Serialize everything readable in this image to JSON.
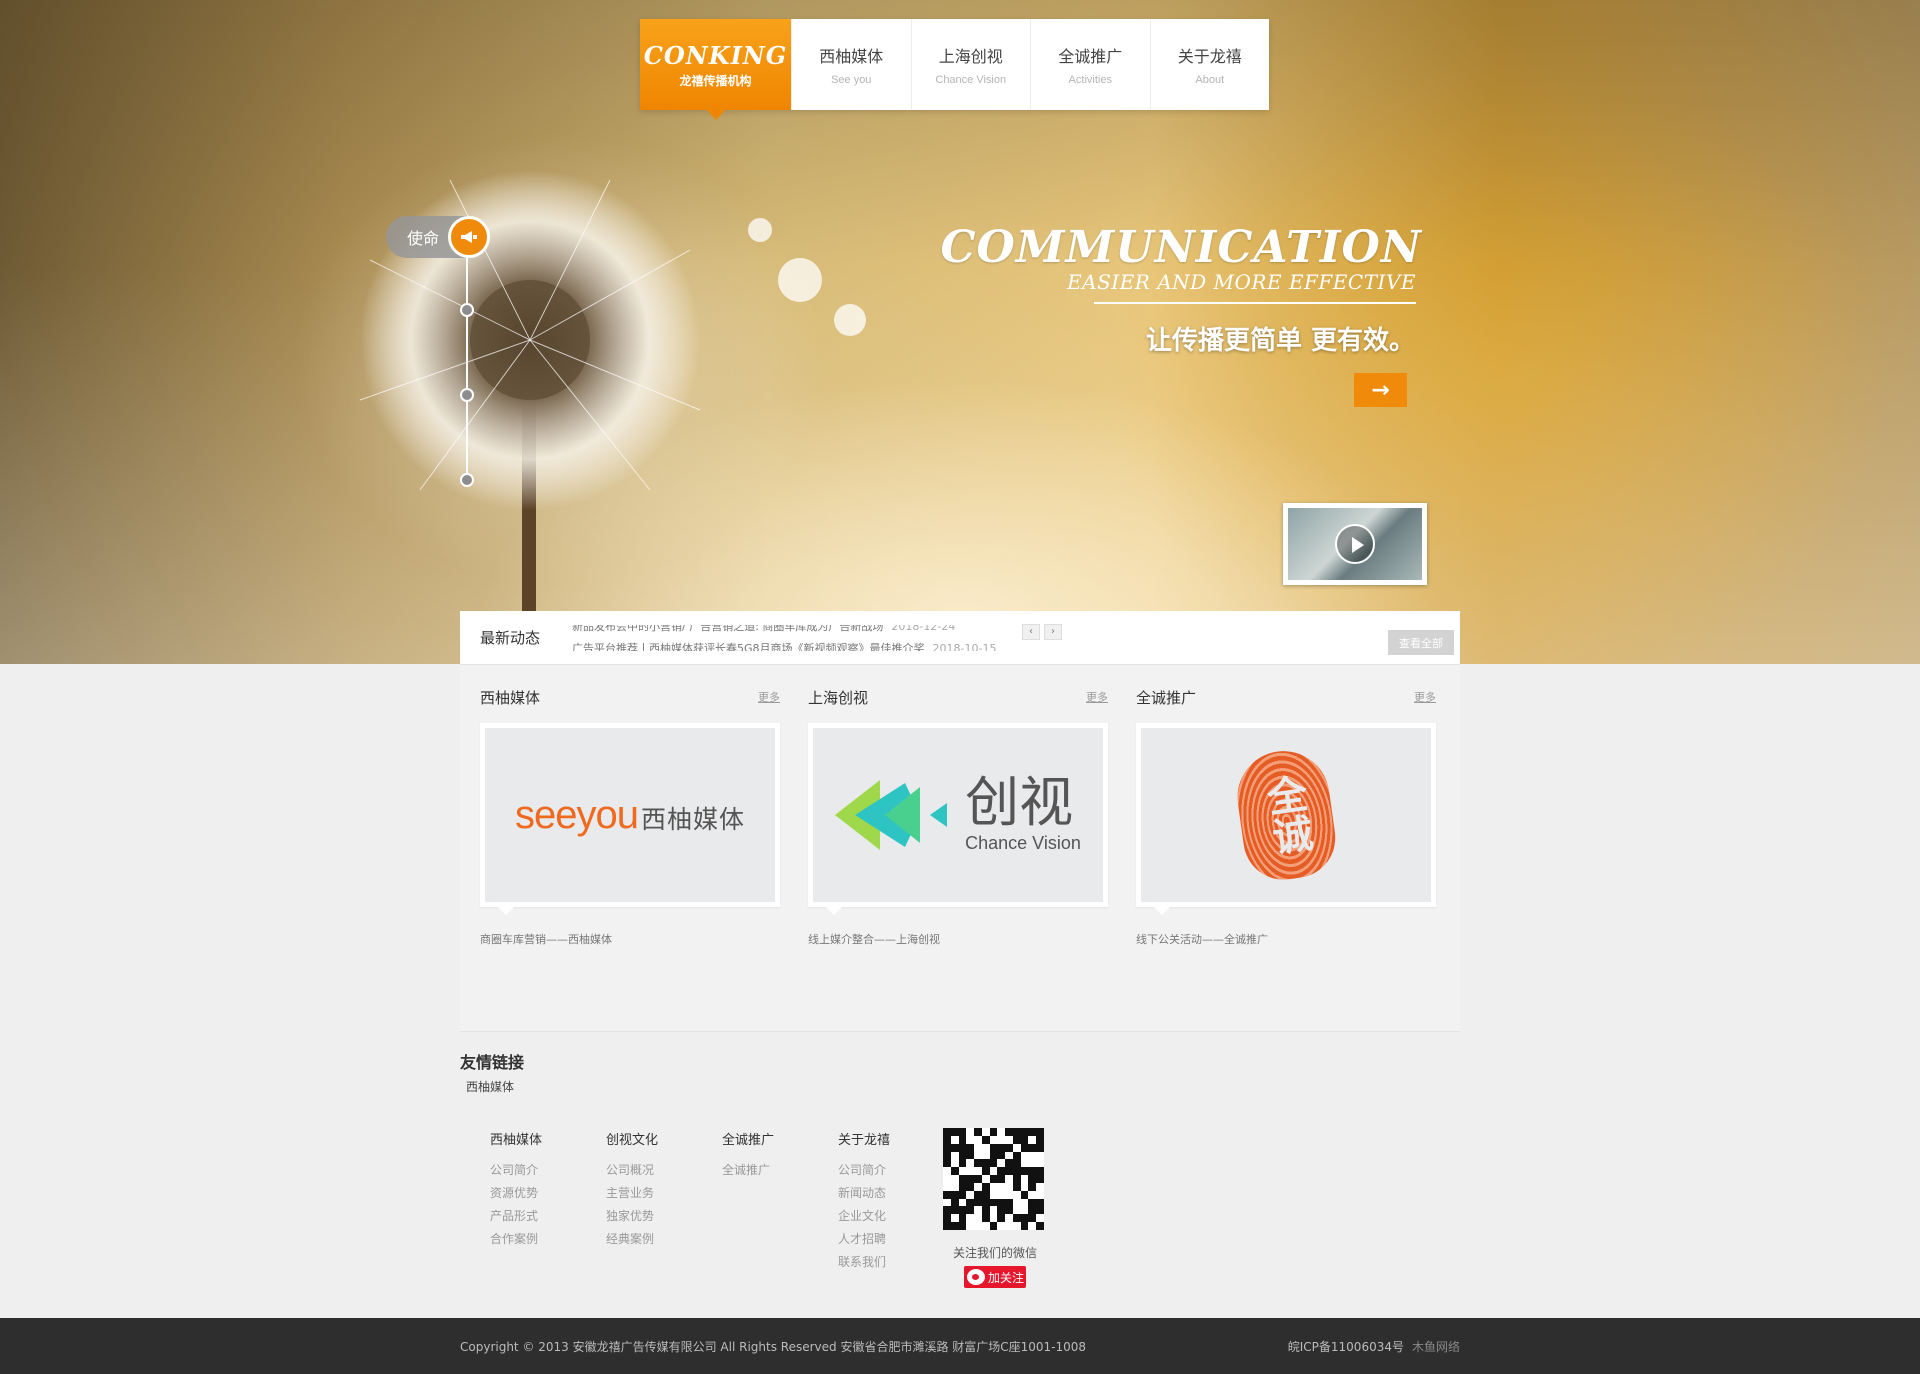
{
  "nav": {
    "logo_mark": "CONKING",
    "logo_sub": "龙禧传播机构",
    "items": [
      {
        "cn": "西柚媒体",
        "en": "See you"
      },
      {
        "cn": "上海创视",
        "en": "Chance Vision"
      },
      {
        "cn": "全诚推广",
        "en": "Activities"
      },
      {
        "cn": "关于龙禧",
        "en": "About"
      }
    ]
  },
  "hero": {
    "mission_label": "使命",
    "slogan_en_1": "COMMUNICATION",
    "slogan_en_2": "EASIER AND MORE EFFECTIVE",
    "slogan_cn": "让传播更简单 更有效。",
    "arrow": "→"
  },
  "news": {
    "title": "最新动态",
    "items": [
      {
        "text": "新品发布会中的小营销/ 广告营销之道: 商圈车库成为广告新战场",
        "date": "2018-12-24"
      },
      {
        "text": "广告平台推荐丨西柚媒体获评长春5G8月商场《新视频观察》最佳推介奖",
        "date": "2018-10-15"
      }
    ],
    "prev": "‹",
    "next": "›",
    "view_all": "查看全部"
  },
  "columns": [
    {
      "title": "西柚媒体",
      "more": "更多",
      "caption": "商圈车库营销——西柚媒体",
      "logo_en": "seeyou",
      "logo_cn": "西柚媒体"
    },
    {
      "title": "上海创视",
      "more": "更多",
      "caption": "线上媒介整合——上海创视",
      "logo_cn": "创视",
      "logo_en": "Chance Vision"
    },
    {
      "title": "全诚推广",
      "more": "更多",
      "caption": "线下公关活动——全诚推广",
      "logo_cn": "全诚"
    }
  ],
  "friends": {
    "title": "友情链接",
    "items": [
      "西柚媒体"
    ]
  },
  "footer_menu": [
    {
      "title": "西柚媒体",
      "items": [
        "公司简介",
        "资源优势",
        "产品形式",
        "合作案例"
      ]
    },
    {
      "title": "创视文化",
      "items": [
        "公司概况",
        "主营业务",
        "独家优势",
        "经典案例"
      ]
    },
    {
      "title": "全诚推广",
      "items": [
        "全诚推广"
      ]
    },
    {
      "title": "关于龙禧",
      "items": [
        "公司简介",
        "新闻动态",
        "企业文化",
        "人才招聘",
        "联系我们"
      ]
    }
  ],
  "social": {
    "qr_label": "关注我们的微信",
    "weibo_label": "加关注"
  },
  "bottom": {
    "copyright": "Copyright © 2013 安徽龙禧广告传媒有限公司  All Rights Reserved  安徽省合肥市濉溪路  财富广场C座1001-1008",
    "icp": "皖ICP备11006034号",
    "maker": "木鱼网络"
  },
  "colors": {
    "accent": "#ef8a0a",
    "footer_bg": "#2e2e2e",
    "weibo": "#e6162d"
  }
}
